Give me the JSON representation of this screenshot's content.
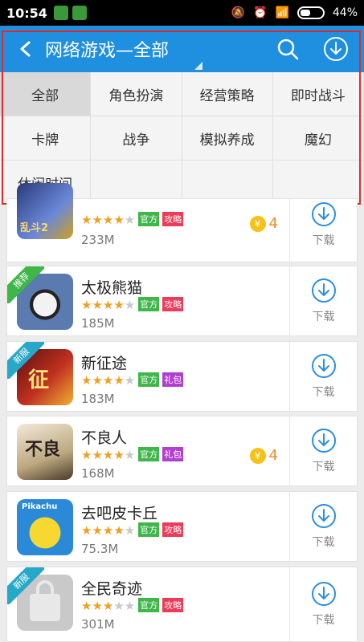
{
  "status": {
    "time": "10:54",
    "battery": "44%"
  },
  "header": {
    "title": "网络游戏—全部"
  },
  "categories": [
    {
      "label": "全部",
      "active": true
    },
    {
      "label": "角色扮演"
    },
    {
      "label": "经营策略"
    },
    {
      "label": "即时战斗"
    },
    {
      "label": "卡牌"
    },
    {
      "label": "战争"
    },
    {
      "label": "模拟养成"
    },
    {
      "label": "魔幻"
    },
    {
      "label": "休闲时间"
    },
    {
      "label": ""
    },
    {
      "label": ""
    },
    {
      "label": ""
    }
  ],
  "tags": {
    "official": "官方",
    "guide": "攻略",
    "gift": "礼包"
  },
  "download_label": "下载",
  "apps": [
    {
      "name": "乱斗2",
      "stars": 4,
      "size": "233M",
      "tag2": "攻略",
      "coin": "4",
      "badge": ""
    },
    {
      "name": "太极熊猫",
      "stars": 4,
      "size": "185M",
      "tag2": "攻略",
      "coin": "",
      "badge": "推荐"
    },
    {
      "name": "新征途",
      "stars": 4,
      "size": "183M",
      "tag2": "礼包",
      "coin": "",
      "badge": "新服"
    },
    {
      "name": "不良人",
      "stars": 4,
      "size": "168M",
      "tag2": "礼包",
      "coin": "4",
      "badge": ""
    },
    {
      "name": "去吧皮卡丘",
      "stars": 3.5,
      "size": "75.3M",
      "tag2": "攻略",
      "coin": "",
      "badge": ""
    },
    {
      "name": "全民奇迹",
      "stars": 2.5,
      "size": "301M",
      "tag2": "攻略",
      "coin": "",
      "badge": "新服"
    }
  ]
}
